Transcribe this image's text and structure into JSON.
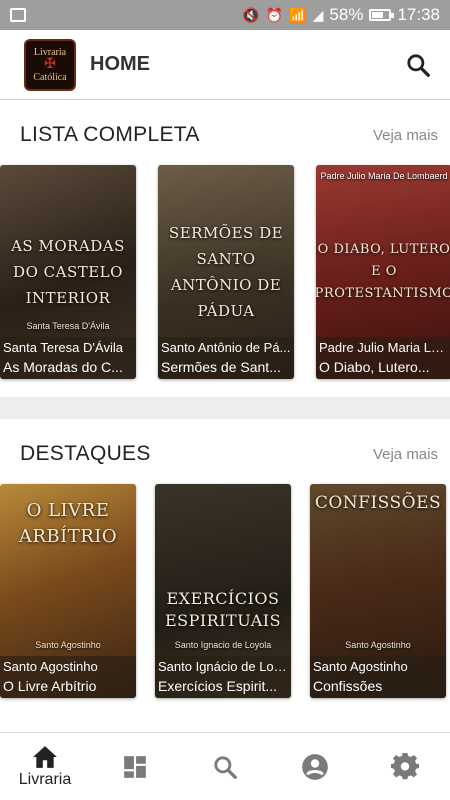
{
  "status_bar": {
    "battery": "58%",
    "time": "17:38"
  },
  "app_bar": {
    "title": "HOME",
    "logo_line1": "Livraria",
    "logo_line2": "Católica"
  },
  "sections": [
    {
      "title": "LISTA COMPLETA",
      "see_more": "Veja mais",
      "books": [
        {
          "art_title": "AS MORADAS DO CASTELO INTERIOR",
          "art_author": "Santa Teresa D'Ávila",
          "author": "Santa Teresa D'Ávila",
          "title": "As Moradas do C..."
        },
        {
          "art_title": "SERMÕES DE SANTO ANTÔNIO DE PÁDUA",
          "art_author": "",
          "author": "Santo Antônio de Pá...",
          "title": "Sermões de Sant..."
        },
        {
          "art_title": "O DIABO, LUTERO E O PROTESTANTISMO",
          "art_author": "Padre Julio Maria De Lombaerd",
          "author": "Padre Julio Maria Lo...",
          "title": "O Diabo, Lutero..."
        }
      ]
    },
    {
      "title": "DESTAQUES",
      "see_more": "Veja mais",
      "books": [
        {
          "art_title": "O LIVRE ARBÍTRIO",
          "art_author": "Santo Agostinho",
          "author": "Santo Agostinho",
          "title": "O Livre Arbítrio"
        },
        {
          "art_title": "EXERCÍCIOS ESPIRITUAIS",
          "art_author": "Santo Ignacio de Loyola",
          "author": "Santo Ignácio de Loy...",
          "title": "Exercícios Espirit..."
        },
        {
          "art_title": "CONFISSÕES",
          "art_author": "Santo Agostinho",
          "author": "Santo Agostinho",
          "title": "Confissões"
        }
      ]
    }
  ],
  "bottom_nav": {
    "active_label": "Livraria",
    "items": [
      "home-icon",
      "dashboard-icon",
      "search-icon",
      "account-icon",
      "settings-icon"
    ]
  }
}
